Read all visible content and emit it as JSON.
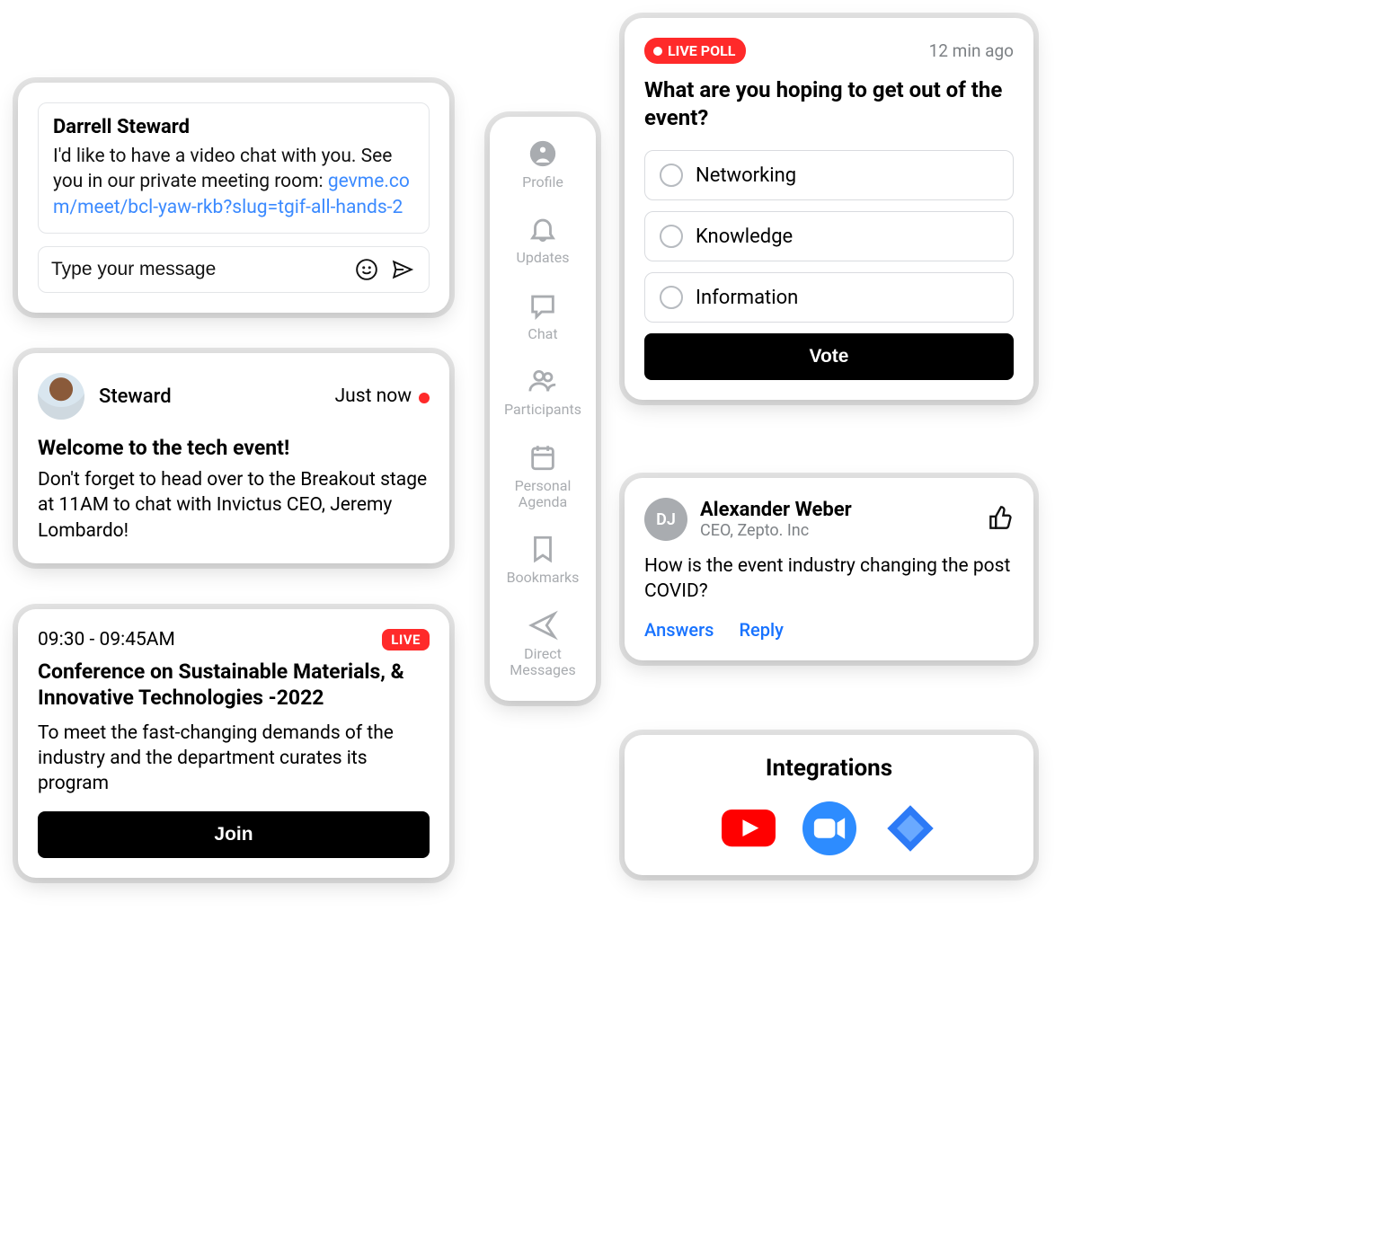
{
  "chat": {
    "sender": "Darrell Steward",
    "body_text": "I'd like to have a video chat with you. See you in our private meeting room: ",
    "link_text": "gevme.com/meet/bcl-yaw-rkb?slug=tgif-all-hands-2",
    "placeholder": "Type your message"
  },
  "notification": {
    "name": "Steward",
    "time": "Just now",
    "title": "Welcome to the tech event!",
    "body": "Don't forget to head over to the Breakout stage at 11AM to chat with Invictus CEO, Jeremy Lombardo!"
  },
  "session": {
    "time": "09:30 - 09:45AM",
    "live_label": "LIVE",
    "title": "Conference on Sustainable Materials, & Innovative Technologies -2022",
    "desc": "To meet the fast-changing demands of the industry and the department curates its program",
    "join_label": "Join"
  },
  "sidebar": {
    "items": [
      {
        "label": "Profile"
      },
      {
        "label": "Updates"
      },
      {
        "label": "Chat"
      },
      {
        "label": "Participants"
      },
      {
        "label": "Personal Agenda"
      },
      {
        "label": "Bookmarks"
      },
      {
        "label": "Direct Messages"
      }
    ]
  },
  "poll": {
    "badge": "LIVE POLL",
    "ago": "12 min ago",
    "question": "What are you hoping to get out of the event?",
    "options": [
      "Networking",
      "Knowledge",
      "Information"
    ],
    "vote_label": "Vote"
  },
  "question": {
    "initials": "DJ",
    "name": "Alexander Weber",
    "role": "CEO, Zepto. Inc",
    "body": "How is the event industry changing the post COVID?",
    "answers_label": "Answers",
    "reply_label": "Reply"
  },
  "integrations": {
    "title": "Integrations"
  }
}
